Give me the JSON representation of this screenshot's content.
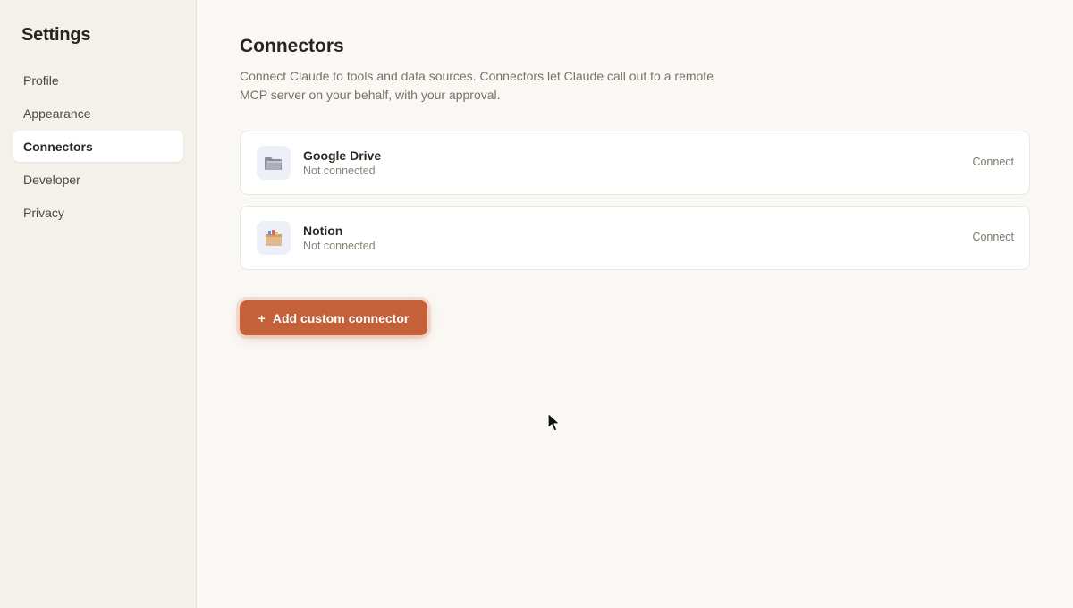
{
  "sidebar": {
    "title": "Settings",
    "items": [
      {
        "label": "Profile",
        "active": false
      },
      {
        "label": "Appearance",
        "active": false
      },
      {
        "label": "Connectors",
        "active": true
      },
      {
        "label": "Developer",
        "active": false
      },
      {
        "label": "Privacy",
        "active": false
      }
    ]
  },
  "main": {
    "title": "Connectors",
    "description": "Connect Claude to tools and data sources. Connectors let Claude call out to a remote MCP server on your behalf, with your approval.",
    "connectors": [
      {
        "name": "Google Drive",
        "status": "Not connected",
        "action": "Connect",
        "icon": "folder-icon"
      },
      {
        "name": "Notion",
        "status": "Not connected",
        "action": "Connect",
        "icon": "box-icon"
      }
    ],
    "add_button": {
      "icon": "+",
      "label": "Add custom connector"
    }
  },
  "colors": {
    "accent": "#c5613a",
    "sidebar_bg": "#f4f1eb",
    "main_bg": "#faf8f4"
  }
}
